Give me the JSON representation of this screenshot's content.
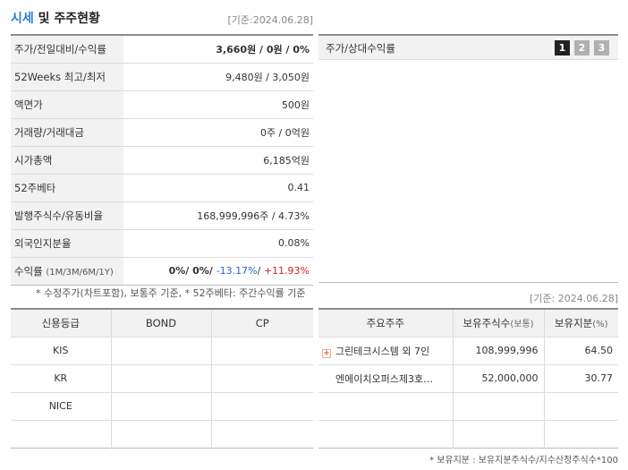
{
  "header": {
    "title_a": "시세",
    "title_b": " 및 주주현황",
    "base_date": "[기준:2024.06.28]"
  },
  "quote_rows": [
    {
      "label": "주가/전일대비/수익률",
      "value": "3,660원 / 0원 / 0%"
    },
    {
      "label": "52Weeks 최고/최저",
      "value": "9,480원 / 3,050원"
    },
    {
      "label": "액면가",
      "value": "500원"
    },
    {
      "label": "거래량/거래대금",
      "value": "0주 / 0억원"
    },
    {
      "label": "시가총액",
      "value": "6,185억원"
    },
    {
      "label": "52주베타",
      "value": "0.41"
    },
    {
      "label": "발행주식수/유동비율",
      "value": "168,999,996주 / 4.73%"
    },
    {
      "label": "외국인지분율",
      "value": "0.08%"
    }
  ],
  "returns": {
    "label": "수익률",
    "periods": "(1M/3M/6M/1Y)",
    "v1": "0%",
    "v2": "0%",
    "v3": "-13.17%",
    "v4": "+11.93%",
    "sep": "/ "
  },
  "note1": "* 수정주가(차트포함), 보통주 기준, * 52주베타: 주간수익률 기준",
  "chart_panel": {
    "label": "주가/상대수익률",
    "buttons": [
      "1",
      "2",
      "3"
    ],
    "active": "1"
  },
  "base_date2": "[기준: 2024.06.28]",
  "credit": {
    "headers": [
      "신용등급",
      "BOND",
      "CP"
    ],
    "rows": [
      [
        "KIS",
        "",
        ""
      ],
      [
        "KR",
        "",
        ""
      ],
      [
        "NICE",
        "",
        ""
      ],
      [
        "",
        "",
        ""
      ]
    ]
  },
  "holders": {
    "headers": {
      "name": "주요주주",
      "shares": "보유주식수",
      "shares_unit": "(보통)",
      "ratio": "보유지분",
      "ratio_unit": "(%)"
    },
    "rows": [
      {
        "name": "그린테크시스템 외 7인",
        "shares": "108,999,996",
        "ratio": "64.50"
      },
      {
        "name": "엔에이치오퍼스제3호…",
        "shares": "52,000,000",
        "ratio": "30.77"
      },
      {
        "name": "",
        "shares": "",
        "ratio": ""
      },
      {
        "name": "",
        "shares": "",
        "ratio": ""
      }
    ]
  },
  "note2": "* 보유지분 : 보유지분주식수/지수산정주식수*100"
}
